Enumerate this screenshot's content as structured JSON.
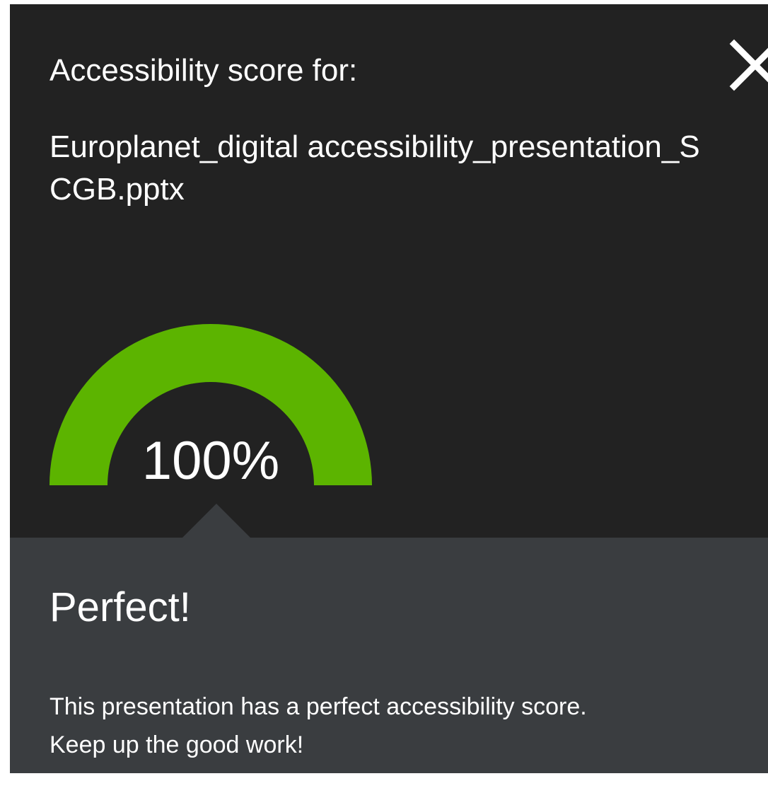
{
  "dialog": {
    "heading": "Accessibility score for:",
    "filename": "Europlanet_digital accessibility_presentation_SCGB.pptx",
    "close_icon": "close-icon"
  },
  "score": {
    "value_label": "100%",
    "fraction": 1.0,
    "color": "#5cb400"
  },
  "result": {
    "verdict": "Perfect!",
    "message_line1": "This presentation has a perfect accessibility score.",
    "message_line2": "Keep up the good work!"
  },
  "colors": {
    "panel_dark": "#222222",
    "panel_result": "#3a3d40",
    "text": "#ffffff"
  }
}
